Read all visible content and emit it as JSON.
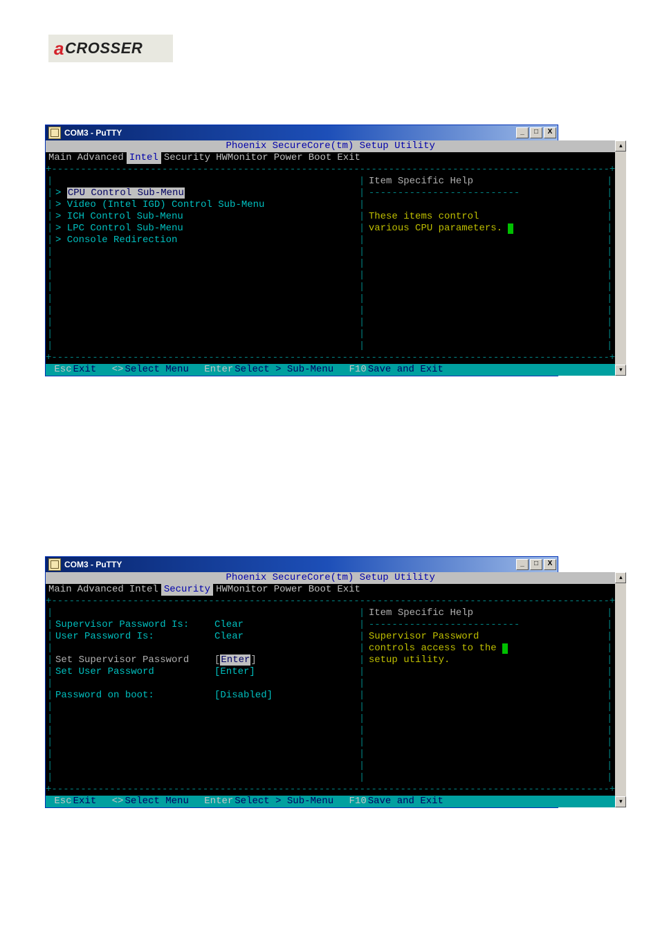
{
  "logo": {
    "first": "a",
    "rest": "CROSSER"
  },
  "windows": [
    {
      "title": "COM3 - PuTTY",
      "bios_title": "Phoenix SecureCore(tm) Setup Utility",
      "tabs": [
        "Main",
        "Advanced",
        "Intel",
        "Security",
        "HWMonitor",
        "Power",
        "Boot",
        "Exit"
      ],
      "active_tab_index": 2,
      "help_title": "Item Specific Help",
      "help_text": [
        "These items control",
        "various CPU parameters."
      ],
      "body_type": "menu",
      "menu_items": [
        {
          "label": "CPU Control Sub-Menu",
          "selected": true
        },
        {
          "label": "Video (Intel IGD) Control Sub-Menu",
          "selected": false
        },
        {
          "label": "ICH Control Sub-Menu",
          "selected": false
        },
        {
          "label": "LPC Control Sub-Menu",
          "selected": false
        },
        {
          "label": "Console Redirection",
          "selected": false
        }
      ],
      "footer": [
        {
          "key": "Esc",
          "label": "Exit"
        },
        {
          "key": "<>",
          "label": "Select Menu"
        },
        {
          "key": "Enter",
          "label": "Select > Sub-Menu"
        },
        {
          "key": "F10",
          "label": "Save and Exit"
        }
      ]
    },
    {
      "title": "COM3 - PuTTY",
      "bios_title": "Phoenix SecureCore(tm) Setup Utility",
      "tabs": [
        "Main",
        "Advanced",
        "Intel",
        "Security",
        "HWMonitor",
        "Power",
        "Boot",
        "Exit"
      ],
      "active_tab_index": 3,
      "help_title": "Item Specific Help",
      "help_text": [
        "Supervisor Password",
        "controls access to the",
        "setup utility."
      ],
      "body_type": "form",
      "form_rows": [
        {
          "label": "Supervisor Password Is:",
          "value": "Clear",
          "gray": false,
          "selected": false
        },
        {
          "label": "User Password Is:",
          "value": "Clear",
          "gray": false,
          "selected": false
        },
        {
          "blank": true
        },
        {
          "label": "Set Supervisor Password",
          "value": "[Enter]",
          "gray": true,
          "selected": true
        },
        {
          "label": "Set User Password",
          "value": "[Enter]",
          "gray": false,
          "selected": false
        },
        {
          "blank": true
        },
        {
          "label": "Password on boot:",
          "value": "[Disabled]",
          "gray": false,
          "selected": false
        }
      ],
      "footer": [
        {
          "key": "Esc",
          "label": "Exit"
        },
        {
          "key": "<>",
          "label": "Select Menu"
        },
        {
          "key": "Enter",
          "label": "Select > Sub-Menu"
        },
        {
          "key": "F10",
          "label": "Save and Exit"
        }
      ]
    }
  ]
}
